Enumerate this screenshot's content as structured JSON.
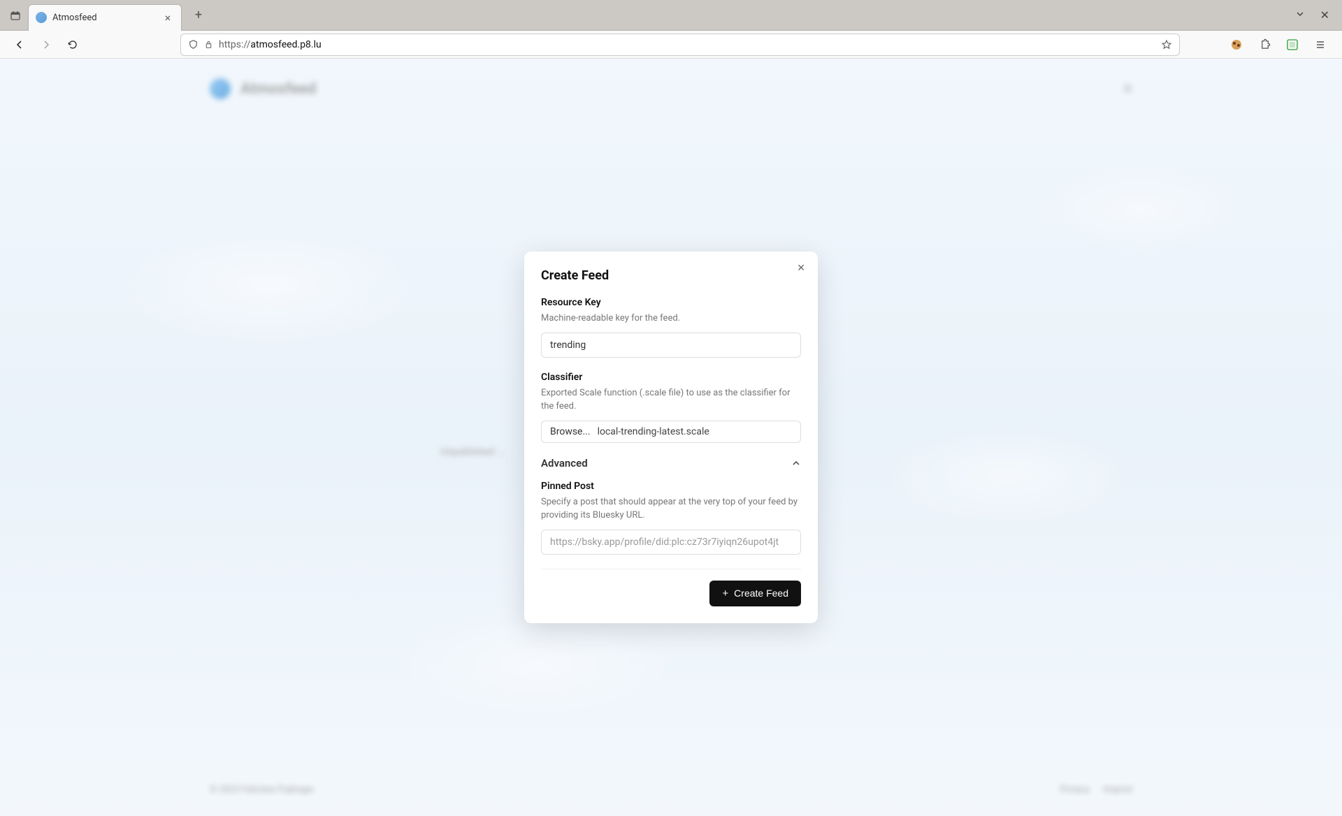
{
  "browser": {
    "tab_title": "Atmosfeed",
    "url_protocol": "https://",
    "url_rest": "atmosfeed.p8.lu"
  },
  "background": {
    "header_title": "Atmosfeed",
    "unpublished_label": "Unpublished ...",
    "footer_copyright": "© 2023 Felicitas Pojtinger",
    "footer_link1": "Privacy",
    "footer_link2": "Imprint"
  },
  "modal": {
    "title": "Create Feed",
    "resource": {
      "label": "Resource Key",
      "desc": "Machine-readable key for the feed.",
      "value": "trending"
    },
    "classifier": {
      "label": "Classifier",
      "desc": "Exported Scale function (.scale file) to use as the classifier for the feed.",
      "browse_label": "Browse...",
      "file_name": "local-trending-latest.scale"
    },
    "advanced": {
      "title": "Advanced"
    },
    "pinned": {
      "label": "Pinned Post",
      "desc": "Specify a post that should appear at the very top of your feed by providing its Bluesky URL.",
      "placeholder": "https://bsky.app/profile/did:plc:cz73r7iyiqn26upot4jt"
    },
    "submit_label": "Create Feed"
  }
}
